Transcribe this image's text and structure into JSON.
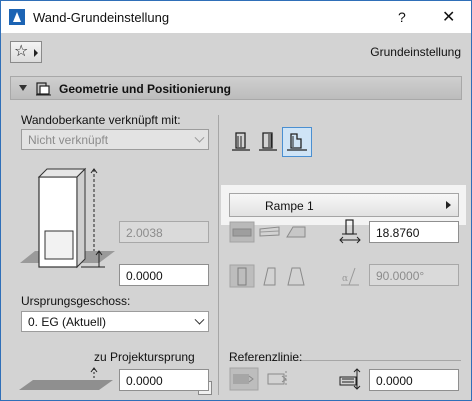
{
  "window": {
    "title": "Wand-Grundeinstellung",
    "help_label": "?",
    "close_label": "✕"
  },
  "toolbar": {
    "favorites_glyph": "☆",
    "preset_label": "Grundeinstellung"
  },
  "section": {
    "title": "Geometrie und Positionierung"
  },
  "top_link": {
    "label": "Wandoberkante verknüpft mit:",
    "value": "Nicht verknüpft"
  },
  "height_field": {
    "value": "2.0038"
  },
  "offset_field": {
    "value": "0.0000"
  },
  "home_story": {
    "label": "Ursprungsgeschoss:",
    "value": "0. EG (Aktuell)"
  },
  "project_zero": {
    "label": "zu Projektursprung",
    "value": "0.0000"
  },
  "profile": {
    "selected_index": 2,
    "rampe_label": "Rampe 1"
  },
  "thickness_field": {
    "value": "18.8760"
  },
  "angle_field": {
    "value": "90.0000°"
  },
  "reference": {
    "label": "Referenzlinie:",
    "offset_value": "0.0000"
  },
  "colors": {
    "accent": "#2f6fb8",
    "selected_bg": "#cfe4f6",
    "panel_bg": "#d3d3d3"
  }
}
